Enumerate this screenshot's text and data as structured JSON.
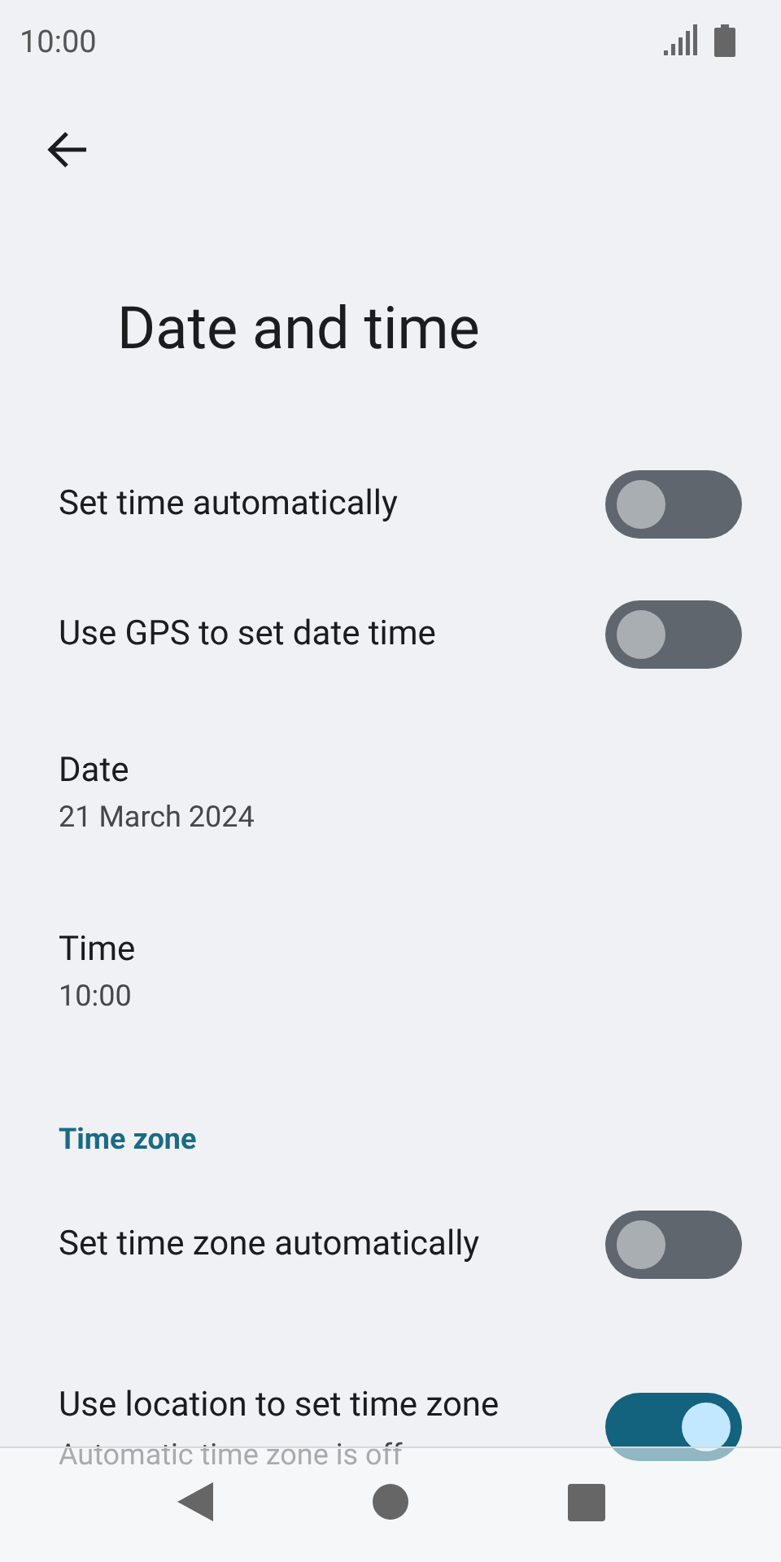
{
  "status_bar": {
    "time": "10:00"
  },
  "title": "Date and time",
  "items": [
    {
      "kind": "switch",
      "title": "Set time automatically",
      "on": false
    },
    {
      "kind": "switch",
      "title": "Use GPS to set date time",
      "on": false
    },
    {
      "kind": "text",
      "title": "Date",
      "summary": "21 March 2024"
    },
    {
      "kind": "text",
      "title": "Time",
      "summary": "10:00"
    },
    {
      "kind": "header",
      "title": "Time zone"
    },
    {
      "kind": "switch",
      "title": "Set time zone automatically",
      "on": false
    },
    {
      "kind": "switch",
      "title": "Use location to set time zone",
      "summary": "Automatic time zone is off",
      "on": true
    }
  ]
}
